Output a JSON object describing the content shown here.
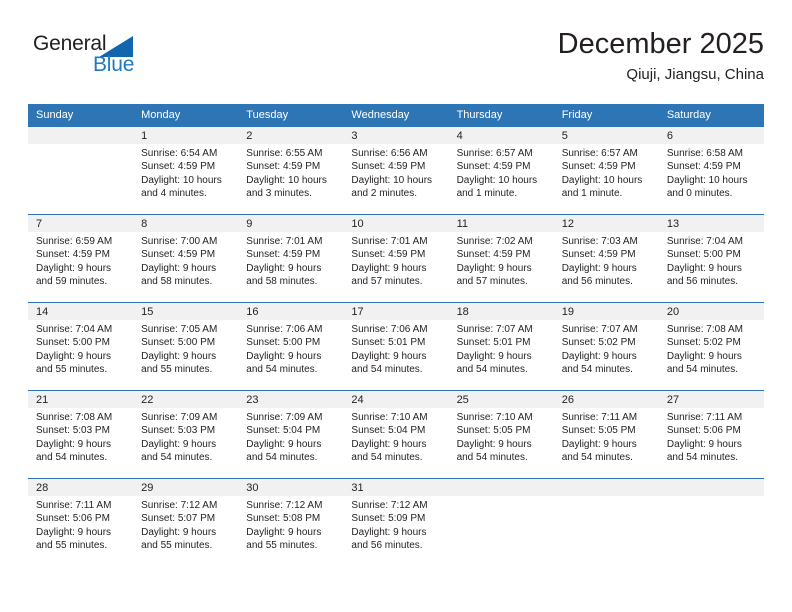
{
  "brand": {
    "name_part1": "General",
    "name_part2": "Blue",
    "accent_color": "#1266ad",
    "text_color": "#231f20"
  },
  "header": {
    "title": "December 2025",
    "subtitle": "Qiuji, Jiangsu, China"
  },
  "calendar": {
    "header_bg": "#2e75b6",
    "daynum_bg": "#f1f1f1",
    "weekdays": [
      "Sunday",
      "Monday",
      "Tuesday",
      "Wednesday",
      "Thursday",
      "Friday",
      "Saturday"
    ],
    "weeks": [
      [
        {
          "day": ""
        },
        {
          "day": "1",
          "sunrise": "Sunrise: 6:54 AM",
          "sunset": "Sunset: 4:59 PM",
          "daylight_line1": "Daylight: 10 hours",
          "daylight_line2": "and 4 minutes."
        },
        {
          "day": "2",
          "sunrise": "Sunrise: 6:55 AM",
          "sunset": "Sunset: 4:59 PM",
          "daylight_line1": "Daylight: 10 hours",
          "daylight_line2": "and 3 minutes."
        },
        {
          "day": "3",
          "sunrise": "Sunrise: 6:56 AM",
          "sunset": "Sunset: 4:59 PM",
          "daylight_line1": "Daylight: 10 hours",
          "daylight_line2": "and 2 minutes."
        },
        {
          "day": "4",
          "sunrise": "Sunrise: 6:57 AM",
          "sunset": "Sunset: 4:59 PM",
          "daylight_line1": "Daylight: 10 hours",
          "daylight_line2": "and 1 minute."
        },
        {
          "day": "5",
          "sunrise": "Sunrise: 6:57 AM",
          "sunset": "Sunset: 4:59 PM",
          "daylight_line1": "Daylight: 10 hours",
          "daylight_line2": "and 1 minute."
        },
        {
          "day": "6",
          "sunrise": "Sunrise: 6:58 AM",
          "sunset": "Sunset: 4:59 PM",
          "daylight_line1": "Daylight: 10 hours",
          "daylight_line2": "and 0 minutes."
        }
      ],
      [
        {
          "day": "7",
          "sunrise": "Sunrise: 6:59 AM",
          "sunset": "Sunset: 4:59 PM",
          "daylight_line1": "Daylight: 9 hours",
          "daylight_line2": "and 59 minutes."
        },
        {
          "day": "8",
          "sunrise": "Sunrise: 7:00 AM",
          "sunset": "Sunset: 4:59 PM",
          "daylight_line1": "Daylight: 9 hours",
          "daylight_line2": "and 58 minutes."
        },
        {
          "day": "9",
          "sunrise": "Sunrise: 7:01 AM",
          "sunset": "Sunset: 4:59 PM",
          "daylight_line1": "Daylight: 9 hours",
          "daylight_line2": "and 58 minutes."
        },
        {
          "day": "10",
          "sunrise": "Sunrise: 7:01 AM",
          "sunset": "Sunset: 4:59 PM",
          "daylight_line1": "Daylight: 9 hours",
          "daylight_line2": "and 57 minutes."
        },
        {
          "day": "11",
          "sunrise": "Sunrise: 7:02 AM",
          "sunset": "Sunset: 4:59 PM",
          "daylight_line1": "Daylight: 9 hours",
          "daylight_line2": "and 57 minutes."
        },
        {
          "day": "12",
          "sunrise": "Sunrise: 7:03 AM",
          "sunset": "Sunset: 4:59 PM",
          "daylight_line1": "Daylight: 9 hours",
          "daylight_line2": "and 56 minutes."
        },
        {
          "day": "13",
          "sunrise": "Sunrise: 7:04 AM",
          "sunset": "Sunset: 5:00 PM",
          "daylight_line1": "Daylight: 9 hours",
          "daylight_line2": "and 56 minutes."
        }
      ],
      [
        {
          "day": "14",
          "sunrise": "Sunrise: 7:04 AM",
          "sunset": "Sunset: 5:00 PM",
          "daylight_line1": "Daylight: 9 hours",
          "daylight_line2": "and 55 minutes."
        },
        {
          "day": "15",
          "sunrise": "Sunrise: 7:05 AM",
          "sunset": "Sunset: 5:00 PM",
          "daylight_line1": "Daylight: 9 hours",
          "daylight_line2": "and 55 minutes."
        },
        {
          "day": "16",
          "sunrise": "Sunrise: 7:06 AM",
          "sunset": "Sunset: 5:00 PM",
          "daylight_line1": "Daylight: 9 hours",
          "daylight_line2": "and 54 minutes."
        },
        {
          "day": "17",
          "sunrise": "Sunrise: 7:06 AM",
          "sunset": "Sunset: 5:01 PM",
          "daylight_line1": "Daylight: 9 hours",
          "daylight_line2": "and 54 minutes."
        },
        {
          "day": "18",
          "sunrise": "Sunrise: 7:07 AM",
          "sunset": "Sunset: 5:01 PM",
          "daylight_line1": "Daylight: 9 hours",
          "daylight_line2": "and 54 minutes."
        },
        {
          "day": "19",
          "sunrise": "Sunrise: 7:07 AM",
          "sunset": "Sunset: 5:02 PM",
          "daylight_line1": "Daylight: 9 hours",
          "daylight_line2": "and 54 minutes."
        },
        {
          "day": "20",
          "sunrise": "Sunrise: 7:08 AM",
          "sunset": "Sunset: 5:02 PM",
          "daylight_line1": "Daylight: 9 hours",
          "daylight_line2": "and 54 minutes."
        }
      ],
      [
        {
          "day": "21",
          "sunrise": "Sunrise: 7:08 AM",
          "sunset": "Sunset: 5:03 PM",
          "daylight_line1": "Daylight: 9 hours",
          "daylight_line2": "and 54 minutes."
        },
        {
          "day": "22",
          "sunrise": "Sunrise: 7:09 AM",
          "sunset": "Sunset: 5:03 PM",
          "daylight_line1": "Daylight: 9 hours",
          "daylight_line2": "and 54 minutes."
        },
        {
          "day": "23",
          "sunrise": "Sunrise: 7:09 AM",
          "sunset": "Sunset: 5:04 PM",
          "daylight_line1": "Daylight: 9 hours",
          "daylight_line2": "and 54 minutes."
        },
        {
          "day": "24",
          "sunrise": "Sunrise: 7:10 AM",
          "sunset": "Sunset: 5:04 PM",
          "daylight_line1": "Daylight: 9 hours",
          "daylight_line2": "and 54 minutes."
        },
        {
          "day": "25",
          "sunrise": "Sunrise: 7:10 AM",
          "sunset": "Sunset: 5:05 PM",
          "daylight_line1": "Daylight: 9 hours",
          "daylight_line2": "and 54 minutes."
        },
        {
          "day": "26",
          "sunrise": "Sunrise: 7:11 AM",
          "sunset": "Sunset: 5:05 PM",
          "daylight_line1": "Daylight: 9 hours",
          "daylight_line2": "and 54 minutes."
        },
        {
          "day": "27",
          "sunrise": "Sunrise: 7:11 AM",
          "sunset": "Sunset: 5:06 PM",
          "daylight_line1": "Daylight: 9 hours",
          "daylight_line2": "and 54 minutes."
        }
      ],
      [
        {
          "day": "28",
          "sunrise": "Sunrise: 7:11 AM",
          "sunset": "Sunset: 5:06 PM",
          "daylight_line1": "Daylight: 9 hours",
          "daylight_line2": "and 55 minutes."
        },
        {
          "day": "29",
          "sunrise": "Sunrise: 7:12 AM",
          "sunset": "Sunset: 5:07 PM",
          "daylight_line1": "Daylight: 9 hours",
          "daylight_line2": "and 55 minutes."
        },
        {
          "day": "30",
          "sunrise": "Sunrise: 7:12 AM",
          "sunset": "Sunset: 5:08 PM",
          "daylight_line1": "Daylight: 9 hours",
          "daylight_line2": "and 55 minutes."
        },
        {
          "day": "31",
          "sunrise": "Sunrise: 7:12 AM",
          "sunset": "Sunset: 5:09 PM",
          "daylight_line1": "Daylight: 9 hours",
          "daylight_line2": "and 56 minutes."
        },
        {
          "day": ""
        },
        {
          "day": ""
        },
        {
          "day": ""
        }
      ]
    ]
  }
}
